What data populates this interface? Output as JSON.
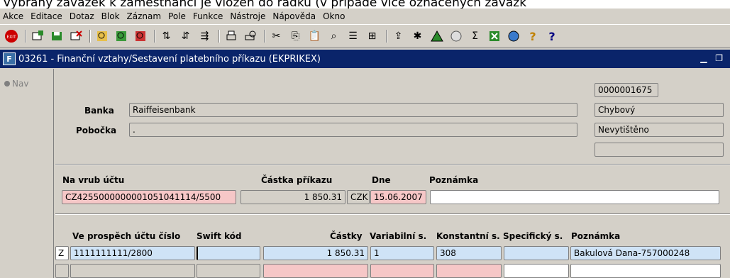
{
  "top_text": "Vybraný závazek k zaměstnanci je vložen do řádku (v případě více označených závazk",
  "menu": [
    "Akce",
    "Editace",
    "Dotaz",
    "Blok",
    "Záznam",
    "Pole",
    "Funkce",
    "Nástroje",
    "Nápověda",
    "Okno"
  ],
  "toolbar_icons": [
    "exit-icon",
    "insert-record-icon",
    "save-record-icon",
    "delete-record-icon",
    "query-icon",
    "execute-query-icon",
    "cancel-query-icon",
    "sort-asc-icon",
    "sort-desc-icon",
    "sort-multi-icon",
    "print-icon",
    "print-preview-icon",
    "cut-icon",
    "copy-icon",
    "paste-icon",
    "find-icon",
    "list-icon",
    "tree-icon",
    "export-icon",
    "tools-icon",
    "warning-icon",
    "clock-icon",
    "sum-icon",
    "excel-icon",
    "web-icon",
    "help-icon",
    "question-icon"
  ],
  "window": {
    "title": "03261 - Finanční vztahy/Sestavení platebního příkazu (EKPRIKEX)",
    "icon_label": "F"
  },
  "nav": {
    "label": "Nav"
  },
  "header": {
    "bank_label": "Banka",
    "bank_value": "Raiffeisenbank",
    "branch_label": "Pobočka",
    "branch_value": ".",
    "doc_number": "0000001675",
    "status": "Chybový",
    "print_status": "Nevytištěno",
    "extra": ""
  },
  "debit": {
    "account_label": "Na vrub účtu",
    "amount_label": "Částka příkazu",
    "date_label": "Dne",
    "note_label": "Poznámka",
    "account_value": "CZ4255000000001051041114/5500",
    "amount_value": "1 850.31",
    "currency": "CZK",
    "date_value": "15.06.2007",
    "note_value": ""
  },
  "credit_headers": {
    "account": "Ve prospěch účtu číslo",
    "swift": "Swift kód",
    "amounts": "Částky",
    "variable": "Variabilní s.",
    "constant": "Konstantní s.",
    "specific": "Specifický s.",
    "note": "Poznámka"
  },
  "credit_rows": [
    {
      "flag": "Z",
      "account": "1111111111/2800",
      "swift": "",
      "amount": "1 850.31",
      "variable": "1",
      "constant": "308",
      "specific": "",
      "note": "Bakulová Dana-757000248"
    },
    {
      "flag": "",
      "account": "",
      "swift": "",
      "amount": "",
      "variable": "",
      "constant": "",
      "specific": "",
      "note": ""
    }
  ]
}
